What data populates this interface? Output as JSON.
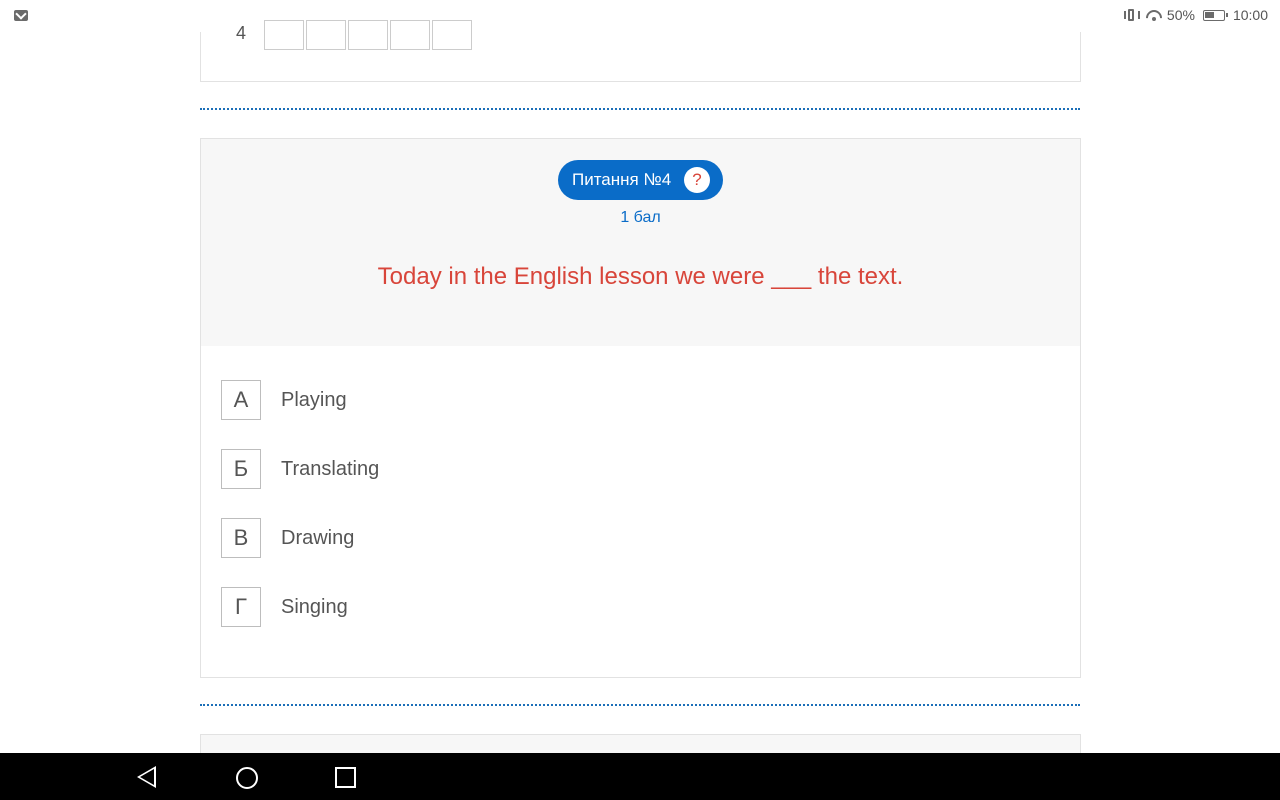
{
  "status_bar": {
    "battery": "50%",
    "time": "10:00",
    "icons": [
      "gmail-icon",
      "vibrate-icon",
      "wifi-icon",
      "battery-icon"
    ]
  },
  "previous_question": {
    "row_number": "4"
  },
  "question": {
    "badge": "Питання №4",
    "help": "?",
    "points": "1 бал",
    "text": "Today in the English lesson we were ___ the text.",
    "answers": [
      {
        "letter": "А",
        "text": "Playing"
      },
      {
        "letter": "Б",
        "text": "Translating"
      },
      {
        "letter": "В",
        "text": "Drawing"
      },
      {
        "letter": "Г",
        "text": "Singing"
      }
    ]
  },
  "colors": {
    "accent": "#0a6cc8",
    "question_text": "#d8453a",
    "card_header_bg": "#f7f7f7"
  },
  "nav_bar": {
    "icons": [
      "back-icon",
      "home-icon",
      "recent-apps-icon"
    ]
  }
}
